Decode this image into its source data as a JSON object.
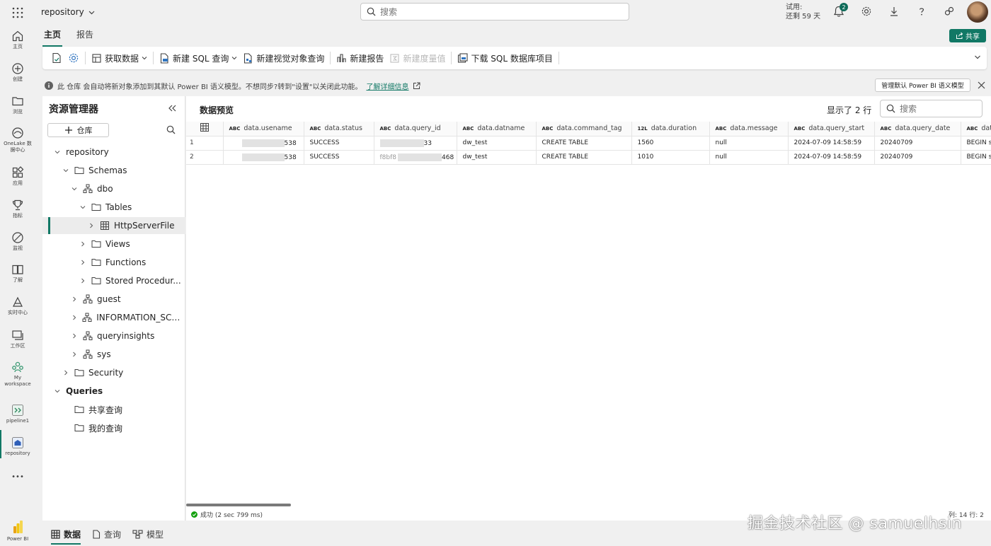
{
  "topbar": {
    "workspace_name": "repository",
    "search_placeholder": "搜索",
    "trial_line1": "试用:",
    "trial_line2": "还剩 59 天",
    "notification_count": "2"
  },
  "rail": {
    "items": [
      {
        "label": "主页",
        "icon": "home-icon"
      },
      {
        "label": "创建",
        "icon": "create-icon"
      },
      {
        "label": "浏览",
        "icon": "browse-folder-icon"
      },
      {
        "label": "OneLake 数据中心",
        "icon": "onelake-icon"
      },
      {
        "label": "应用",
        "icon": "apps-icon"
      },
      {
        "label": "指标",
        "icon": "trophy-icon"
      },
      {
        "label": "监视",
        "icon": "monitor-icon"
      },
      {
        "label": "了解",
        "icon": "book-icon"
      },
      {
        "label": "实时中心",
        "icon": "realtime-icon"
      },
      {
        "label": "工作区",
        "icon": "workspaces-icon"
      },
      {
        "label": "My workspace",
        "icon": "my-workspace-icon"
      },
      {
        "label": "pipeline1",
        "icon": "pipeline-icon"
      },
      {
        "label": "repository",
        "icon": "warehouse-icon"
      }
    ],
    "more_label": "•••",
    "product_label": "Power BI"
  },
  "ribbon": {
    "tabs": [
      {
        "label": "主页"
      },
      {
        "label": "报告"
      }
    ],
    "share_label": "共享",
    "buttons": {
      "get_data": "获取数据",
      "new_sql": "新建 SQL 查询",
      "new_visual": "新建视觉对象查询",
      "new_report": "新建报告",
      "new_measure": "新建度量值",
      "download_sql": "下载 SQL 数据库项目"
    }
  },
  "infobar": {
    "message": "此 仓库 会自动将新对象添加到其默认 Power BI 语义模型。不想同步?转到\"设置\"以关闭此功能。",
    "link": "了解详细信息",
    "manage_button": "管理默认 Power BI 语义模型"
  },
  "explorer": {
    "title": "资源管理器",
    "warehouse_button": "仓库",
    "tree": [
      {
        "label": "repository",
        "level": 0,
        "chev": "down",
        "icon": ""
      },
      {
        "label": "Schemas",
        "level": 1,
        "chev": "down",
        "icon": "folder"
      },
      {
        "label": "dbo",
        "level": 2,
        "chev": "down",
        "icon": "schema"
      },
      {
        "label": "Tables",
        "level": 3,
        "chev": "down",
        "icon": "folder"
      },
      {
        "label": "HttpServerFile",
        "level": 4,
        "chev": "right",
        "icon": "table",
        "selected": true
      },
      {
        "label": "Views",
        "level": 3,
        "chev": "right",
        "icon": "folder"
      },
      {
        "label": "Functions",
        "level": 3,
        "chev": "right",
        "icon": "folder"
      },
      {
        "label": "Stored Procedur...",
        "level": 3,
        "chev": "right",
        "icon": "folder"
      },
      {
        "label": "guest",
        "level": 2,
        "chev": "right",
        "icon": "schema"
      },
      {
        "label": "INFORMATION_SCHE...",
        "level": 2,
        "chev": "right",
        "icon": "schema"
      },
      {
        "label": "queryinsights",
        "level": 2,
        "chev": "right",
        "icon": "schema"
      },
      {
        "label": "sys",
        "level": 2,
        "chev": "right",
        "icon": "schema"
      },
      {
        "label": "Security",
        "level": 1,
        "chev": "right",
        "icon": "folder"
      },
      {
        "label": "Queries",
        "level": 0,
        "chev": "down",
        "icon": ""
      },
      {
        "label": "共享查询",
        "level": 1,
        "chev": "",
        "icon": "folder"
      },
      {
        "label": "我的查询",
        "level": 1,
        "chev": "",
        "icon": "folder"
      }
    ]
  },
  "preview": {
    "title": "数据预览",
    "row_count_text": "显示了 2 行",
    "search_placeholder": "搜索",
    "columns": [
      {
        "type": "ABC",
        "name": "data.usename"
      },
      {
        "type": "ABC",
        "name": "data.status"
      },
      {
        "type": "ABC",
        "name": "data.query_id"
      },
      {
        "type": "ABC",
        "name": "data.datname"
      },
      {
        "type": "ABC",
        "name": "data.command_tag"
      },
      {
        "type": "12L",
        "name": "data.duration"
      },
      {
        "type": "ABC",
        "name": "data.message"
      },
      {
        "type": "ABC",
        "name": "data.query_start"
      },
      {
        "type": "ABC",
        "name": "data.query_date"
      },
      {
        "type": "ABC",
        "name": "dat"
      }
    ],
    "rows": [
      {
        "index": "1",
        "cells": [
          "538",
          "SUCCESS",
          "33",
          "dw_test",
          "CREATE TABLE",
          "1560",
          "null",
          "2024-07-09 14:58:59",
          "20240709",
          "BEGIN s"
        ]
      },
      {
        "index": "2",
        "cells": [
          "538",
          "SUCCESS",
          "468",
          "dw_test",
          "CREATE TABLE",
          "1010",
          "null",
          "2024-07-09 14:58:59",
          "20240709",
          "BEGIN s"
        ]
      }
    ],
    "row2_query_prefix": "f8bf8",
    "status_text": "成功 (2 sec 799 ms)",
    "status_right": "列: 14 行: 2"
  },
  "bottom_tabs": [
    {
      "label": "数据"
    },
    {
      "label": "查询"
    },
    {
      "label": "模型"
    }
  ],
  "watermark": "掘金技术社区 @ samuelhsin",
  "colors": {
    "accent": "#117865",
    "background": "#f0f0f0",
    "panel": "#ffffff"
  }
}
